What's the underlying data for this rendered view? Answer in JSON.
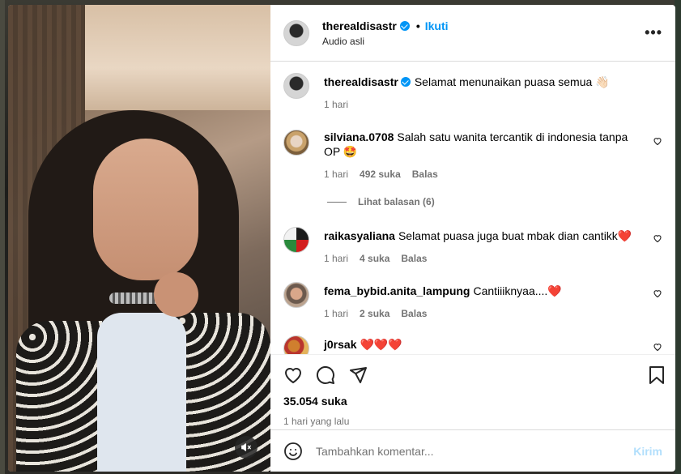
{
  "post": {
    "username": "therealdisastr",
    "follow_label": "Ikuti",
    "separator": "•",
    "audio_label": "Audio asli",
    "more_label": "•••"
  },
  "caption": {
    "username": "therealdisastr",
    "text": "Selamat menunaikan puasa semua 👋🏻",
    "time": "1 hari"
  },
  "comments": [
    {
      "username": "silviana.0708",
      "text": "Salah satu wanita tercantik di indonesia tanpa OP 🤩",
      "time": "1 hari",
      "likes": "492 suka",
      "reply": "Balas",
      "view_replies": "Lihat balasan (6)"
    },
    {
      "username": "raikasyaliana",
      "text": "Selamat puasa juga buat mbak dian cantikk❤️",
      "time": "1 hari",
      "likes": "4 suka",
      "reply": "Balas"
    },
    {
      "username": "fema_bybid.anita_lampung",
      "text": "Cantiiiknyaa....❤️",
      "time": "1 hari",
      "likes": "2 suka",
      "reply": "Balas"
    },
    {
      "username": "j0rsak",
      "text": "❤️❤️❤️"
    }
  ],
  "stats": {
    "likes": "35.054 suka",
    "posted": "1 hari yang lalu"
  },
  "composer": {
    "placeholder": "Tambahkan komentar...",
    "send_label": "Kirim"
  },
  "icons": {
    "like": "heart-icon",
    "comment": "comment-icon",
    "share": "send-icon",
    "save": "bookmark-icon",
    "emoji": "emoji-icon",
    "mute": "speaker-muted-icon",
    "more": "more-horizontal-icon"
  },
  "colors": {
    "accent": "#0095f6",
    "send_disabled": "#b2dffc",
    "muted_text": "#737373"
  }
}
